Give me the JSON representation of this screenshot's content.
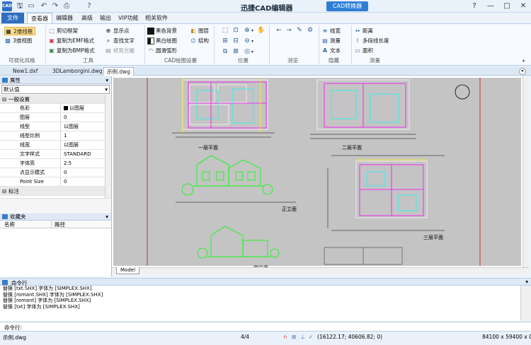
{
  "app": {
    "logo_text": "CAD",
    "title": "迅捷CAD编辑器",
    "converter_label": "CAD转换器",
    "quick_access": [
      "save-icon",
      "open-icon",
      "undo-icon",
      "redo-icon",
      "print-icon",
      "help-icon"
    ]
  },
  "menu": {
    "tabs": [
      "文件",
      "查看器",
      "编辑器",
      "高级",
      "输出",
      "VIP功能",
      "相关软件"
    ]
  },
  "ribbon": {
    "view_style": {
      "btn2d": "2维线框",
      "btn3d": "3维视图",
      "label": "可视化风格"
    },
    "tools": {
      "items": [
        "剪切框架",
        "复制为EMF格式",
        "复制为BMP格式",
        "显示点",
        "查找文字",
        "修剪光栅"
      ],
      "label": "工具"
    },
    "cad_settings": {
      "items": [
        "黑色背景",
        "黑白绘图",
        "圆滑弧形",
        "图层",
        "结构"
      ],
      "label": "CAD绘图设置"
    },
    "position": {
      "label": "位置"
    },
    "browse": {
      "label": "浏览"
    },
    "hide": {
      "items": [
        "线宽",
        "测量",
        "文本"
      ],
      "label": "隐藏"
    },
    "measure": {
      "items": [
        "距离",
        "多段线长度",
        "面积"
      ],
      "label": "测量"
    }
  },
  "doc_tabs": [
    "New1.dxf",
    "3DLamborgini.dwg",
    "示例.dwg"
  ],
  "properties": {
    "title": "属性",
    "dropdown_value": "默认值",
    "section_general": "一般设置",
    "rows": [
      {
        "k": "色彩",
        "v": "以图层"
      },
      {
        "k": "图层",
        "v": "0"
      },
      {
        "k": "线型",
        "v": "以图层"
      },
      {
        "k": "线型比例",
        "v": "1"
      },
      {
        "k": "线宽",
        "v": "以图层"
      },
      {
        "k": "文字样式",
        "v": "STANDARD"
      },
      {
        "k": "字体高",
        "v": "2.5"
      },
      {
        "k": "点显示模式",
        "v": "0"
      },
      {
        "k": "Point Size",
        "v": "0"
      }
    ],
    "section_annot": "标注"
  },
  "favorites": {
    "title": "收藏夹",
    "col_name": "名称",
    "col_path": "路径"
  },
  "drawing": {
    "labels": [
      "一层平面",
      "二层平面",
      "正立面",
      "三层平面",
      "侧立面"
    ],
    "model_tab": "Model"
  },
  "command": {
    "title": "命令行",
    "log": [
      "替换 [txt.SHX] 字体为 [SIMPLEX.SHX]",
      "替换 [romant.SHX] 字体为 [SIMPLEX.SHX]",
      "替换 [romant] 字体为 [SIMPLEX.SHX]",
      "替换 [txt] 字体为 [SIMPLEX.SHX]"
    ],
    "input_label": "命令行:"
  },
  "status": {
    "file": "示例.dwg",
    "page": "4/4",
    "coords": "(16122.17; 40606.82; 0)",
    "size": "84100 x 59400 x 0"
  },
  "colors": {
    "accent": "#2f6fc0",
    "canvas_bg": "#c4c4c4"
  }
}
